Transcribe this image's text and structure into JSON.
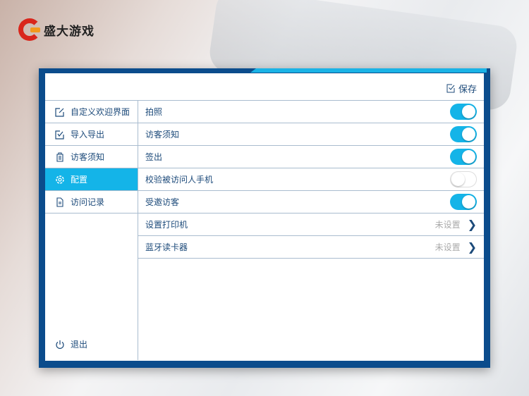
{
  "brand": {
    "logo_text": "盛大游戏"
  },
  "header": {
    "save_label": "保存"
  },
  "sidebar": {
    "items": [
      {
        "label": "自定义欢迎界面",
        "icon": "edit-icon"
      },
      {
        "label": "导入导出",
        "icon": "import-export-icon"
      },
      {
        "label": "访客须知",
        "icon": "notice-icon"
      },
      {
        "label": "配置",
        "icon": "gear-icon",
        "active": true
      },
      {
        "label": "访问记录",
        "icon": "document-icon"
      }
    ],
    "exit_label": "退出"
  },
  "settings": [
    {
      "label": "拍照",
      "type": "toggle",
      "on": true
    },
    {
      "label": "访客须知",
      "type": "toggle",
      "on": true
    },
    {
      "label": "签出",
      "type": "toggle",
      "on": true
    },
    {
      "label": "校验被访问人手机",
      "type": "toggle",
      "on": false
    },
    {
      "label": "受邀访客",
      "type": "toggle",
      "on": true
    },
    {
      "label": "设置打印机",
      "type": "link",
      "value": "未设置"
    },
    {
      "label": "蓝牙读卡器",
      "type": "link",
      "value": "未设置"
    }
  ],
  "colors": {
    "frame": "#0b4c8c",
    "accent": "#14b4e8",
    "text": "#1c4a7a"
  }
}
